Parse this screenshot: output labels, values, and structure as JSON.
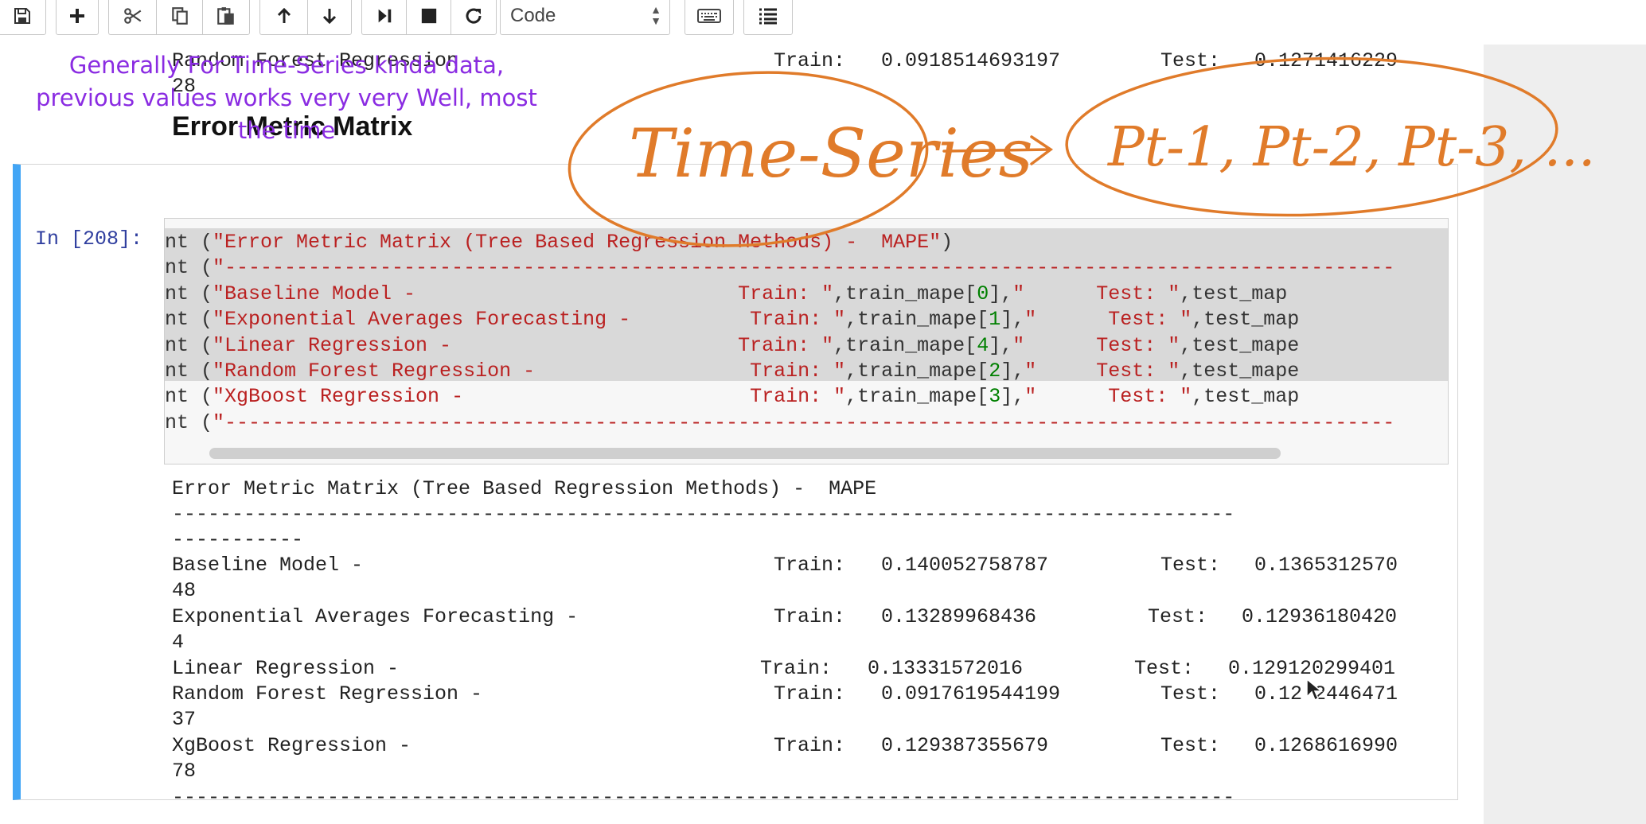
{
  "toolbar": {
    "buttons": [
      {
        "icon": "save-icon"
      },
      {
        "icon": "plus-icon"
      },
      {
        "icon": "cut-icon"
      },
      {
        "icon": "copy-icon"
      },
      {
        "icon": "paste-icon"
      },
      {
        "icon": "arrow-up-icon"
      },
      {
        "icon": "arrow-down-icon"
      },
      {
        "icon": "run-step-icon"
      },
      {
        "icon": "stop-icon"
      },
      {
        "icon": "restart-icon"
      },
      {
        "icon": "keyboard-icon"
      },
      {
        "icon": "command-palette-icon"
      }
    ],
    "cell_type": "Code"
  },
  "previous_output": {
    "line1_name": "Random Forest Regression -",
    "line1_train_label": "Train:",
    "line1_train_value": "0.0918514693197",
    "line1_test_label": "Test:",
    "line1_test_value": "0.1271416229",
    "line2": "28"
  },
  "annotation": {
    "note": "Generally For Time-Series kinda data, previous values works very very Well, most the time",
    "handwritten_left": "Time-Series",
    "handwritten_right": "Pt-1, Pt-2, Pt-3, ...",
    "ink_color": "#e07b2a",
    "note_color": "#8a2be2"
  },
  "heading": "Error Metric Matrix",
  "cell": {
    "prompt": "In [208]:",
    "code_lines": [
      {
        "pre": "nt (",
        "str": "\"Error Metric Matrix (Tree Based Regression Methods) -  MAPE\"",
        "post": ")"
      },
      {
        "pre": "nt (",
        "str": "\"--------------------------------------------------------------------------------------------------",
        "post": ""
      },
      {
        "pre": "nt (",
        "str": "\"Baseline Model -                           Train: \"",
        "post": ",train_mape[",
        "num": "0",
        "post2": "],",
        "str2": "\"      Test: \"",
        "post3": ",test_map"
      },
      {
        "pre": "nt (",
        "str": "\"Exponential Averages Forecasting -          Train: \"",
        "post": ",train_mape[",
        "num": "1",
        "post2": "],",
        "str2": "\"      Test: \"",
        "post3": ",test_map"
      },
      {
        "pre": "nt (",
        "str": "\"Linear Regression -                        Train: \"",
        "post": ",train_mape[",
        "num": "4",
        "post2": "],",
        "str2": "\"      Test: \"",
        "post3": ",test_mape"
      },
      {
        "pre": "nt (",
        "str": "\"Random Forest Regression -                  Train: \"",
        "post": ",train_mape[",
        "num": "2",
        "post2": "],",
        "str2": "\"     Test: \"",
        "post3": ",test_mape"
      },
      {
        "pre": "nt (",
        "str": "\"XgBoost Regression -                        Train: \"",
        "post": ",train_mape[",
        "num": "3",
        "post2": "],",
        "str2": "\"      Test: \"",
        "post3": ",test_map"
      },
      {
        "pre": "nt (",
        "str": "\"--------------------------------------------------------------------------------------------------",
        "post": ""
      }
    ]
  },
  "output": {
    "title": "Error Metric Matrix (Tree Based Regression Methods) -  MAPE",
    "dash_line": "-----------------------------------------------------------------------------------------",
    "dash_wrap": "-----------",
    "rows": [
      {
        "name": "Baseline Model -",
        "train_label": "Train:",
        "train": "0.140052758787",
        "test_label": "Test:",
        "test": "0.1365312570",
        "wrap": "48"
      },
      {
        "name": "Exponential Averages Forecasting -",
        "train_label": "Train:",
        "train": "0.13289968436",
        "test_label": "Test:",
        "test": "0.12936180420",
        "wrap": "4"
      },
      {
        "name": "Linear Regression -",
        "train_label": "Train:",
        "train": "0.13331572016",
        "test_label": "Test:",
        "test": "0.129120299401",
        "wrap": ""
      },
      {
        "name": "Random Forest Regression -",
        "train_label": "Train:",
        "train": "0.0917619544199",
        "test_label": "Test:",
        "test": "0.12 2446471",
        "wrap": "37"
      },
      {
        "name": "XgBoost Regression -",
        "train_label": "Train:",
        "train": "0.129387355679",
        "test_label": "Test:",
        "test": "0.1268616990",
        "wrap": "78"
      }
    ],
    "dash_bottom": "-----------------------------------------------------------------------------------------"
  }
}
